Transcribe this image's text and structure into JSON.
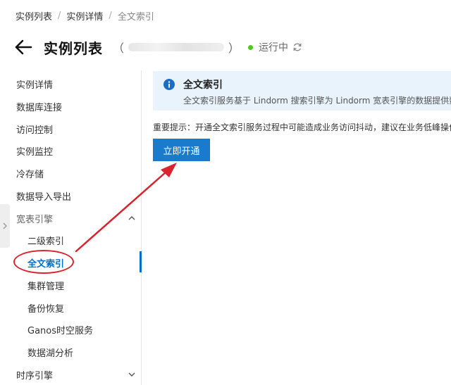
{
  "breadcrumb": [
    "实例列表",
    "实例详情",
    "全文索引"
  ],
  "header": {
    "title": "实例列表",
    "paren_open": "（",
    "paren_close": "）",
    "status": "运行中",
    "status_color": "#52c41a"
  },
  "sidebar": {
    "items": [
      {
        "label": "实例详情"
      },
      {
        "label": "数据库连接"
      },
      {
        "label": "访问控制"
      },
      {
        "label": "实例监控"
      },
      {
        "label": "冷存储"
      },
      {
        "label": "数据导入导出"
      }
    ],
    "group_wide": {
      "label": "宽表引擎",
      "expanded": true,
      "children": [
        {
          "label": "二级索引"
        },
        {
          "label": "全文索引",
          "active": true
        },
        {
          "label": "集群管理"
        },
        {
          "label": "备份恢复"
        },
        {
          "label": "Ganos时空服务"
        },
        {
          "label": "数据湖分析"
        }
      ]
    },
    "group_ts": {
      "label": "时序引擎",
      "expanded": false
    }
  },
  "main": {
    "banner": {
      "title": "全文索引",
      "desc": "全文索引服务基于 Lindorm 搜索引擎为 Lindorm 宽表引擎的数据提供数"
    },
    "notice": "重要提示：开通全文索引服务过程中可能造成业务访问抖动，建议在业务低峰操作",
    "button_label": "立即开通"
  },
  "colors": {
    "accent": "#0070cc",
    "button": "#1a7bcc",
    "banner_bg": "#e8f3fc",
    "annotation": "#d9242e"
  }
}
